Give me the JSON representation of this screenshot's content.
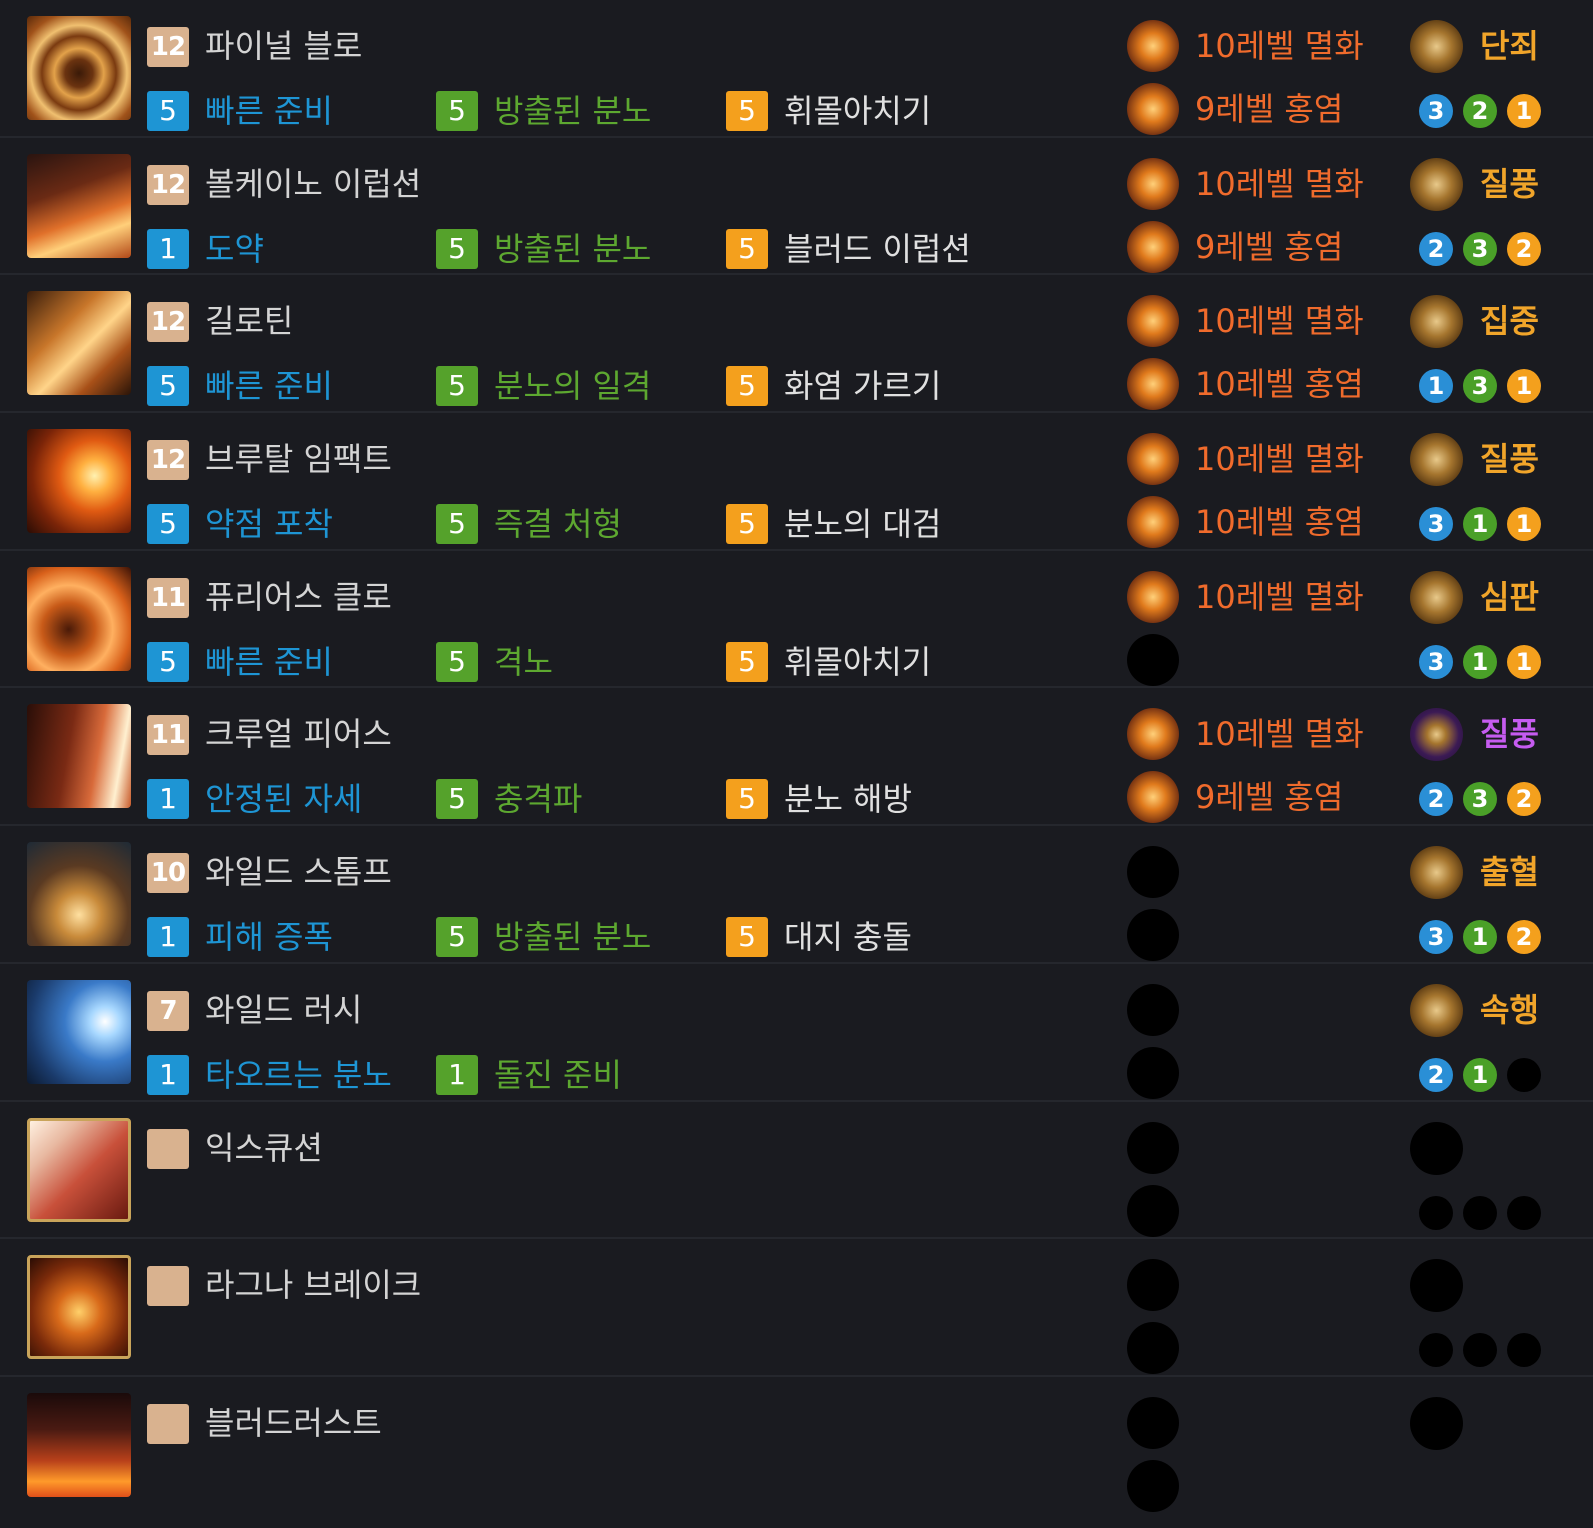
{
  "skills": [
    {
      "name": "파이널 블로",
      "level": "12",
      "icon": "swirl-strike-icon",
      "framed": false,
      "icon_bg": "radial-gradient(circle at 50% 55%, #3a1a08 0%, #6b3310 18%, #e3a24a 32%, #7a3a10 48%, #f0c070 62%, #a0521a 80%, #5a2a0a 100%)",
      "tripods": [
        {
          "level": "5",
          "name": "빠른 준비"
        },
        {
          "level": "5",
          "name": "방출된 분노"
        },
        {
          "level": "5",
          "name": "휘몰아치기"
        }
      ],
      "gems": [
        {
          "label": "10레벨 멸화"
        },
        {
          "label": "9레벨 홍염"
        }
      ],
      "stone": {
        "label": "단죄",
        "style": "normal"
      },
      "dots": [
        "3",
        "2",
        "1"
      ]
    },
    {
      "name": "볼케이노 이럽션",
      "level": "12",
      "icon": "sword-eruption-icon",
      "framed": false,
      "icon_bg": "linear-gradient(160deg, #2a1410 0%, #6a2a14 35%, #e0702a 60%, #ffcf7a 75%, #b24818 100%)",
      "tripods": [
        {
          "level": "1",
          "name": "도약"
        },
        {
          "level": "5",
          "name": "방출된 분노"
        },
        {
          "level": "5",
          "name": "블러드 이럽션"
        }
      ],
      "gems": [
        {
          "label": "10레벨 멸화"
        },
        {
          "label": "9레벨 홍염"
        }
      ],
      "stone": {
        "label": "질풍",
        "style": "normal"
      },
      "dots": [
        "2",
        "3",
        "2"
      ]
    },
    {
      "name": "길로틴",
      "level": "12",
      "icon": "guillotine-slash-icon",
      "framed": false,
      "icon_bg": "linear-gradient(135deg, #3a1e0c 0%, #c8762a 35%, #ffd489 55%, #a85018 75%, #2a1408 100%)",
      "tripods": [
        {
          "level": "5",
          "name": "빠른 준비"
        },
        {
          "level": "5",
          "name": "분노의 일격"
        },
        {
          "level": "5",
          "name": "화염 가르기"
        }
      ],
      "gems": [
        {
          "label": "10레벨 멸화"
        },
        {
          "label": "10레벨 홍염"
        }
      ],
      "stone": {
        "label": "집중",
        "style": "normal"
      },
      "dots": [
        "1",
        "3",
        "1"
      ]
    },
    {
      "name": "브루탈 임팩트",
      "level": "12",
      "icon": "brutal-impact-icon",
      "framed": false,
      "icon_bg": "radial-gradient(circle at 65% 45%, #fff1b0 0%, #ffb040 18%, #e05a12 40%, #7a2408 70%, #2a0c04 100%)",
      "tripods": [
        {
          "level": "5",
          "name": "약점 포착"
        },
        {
          "level": "5",
          "name": "즉결 처형"
        },
        {
          "level": "5",
          "name": "분노의 대검"
        }
      ],
      "gems": [
        {
          "label": "10레벨 멸화"
        },
        {
          "label": "10레벨 홍염"
        }
      ],
      "stone": {
        "label": "질풍",
        "style": "normal"
      },
      "dots": [
        "3",
        "1",
        "1"
      ]
    },
    {
      "name": "퓨리어스 클로",
      "level": "11",
      "icon": "furious-claw-icon",
      "framed": false,
      "icon_bg": "radial-gradient(circle at 40% 60%, #4a1a08 0%, #c85a18 30%, #ffb060 50%, #d8601a 70%, #3a1206 100%)",
      "tripods": [
        {
          "level": "5",
          "name": "빠른 준비"
        },
        {
          "level": "5",
          "name": "격노"
        },
        {
          "level": "5",
          "name": "휘몰아치기"
        }
      ],
      "gems": [
        {
          "label": "10레벨 멸화"
        },
        {
          "label": ""
        }
      ],
      "stone": {
        "label": "심판",
        "style": "normal"
      },
      "dots": [
        "3",
        "1",
        "1"
      ]
    },
    {
      "name": "크루얼 피어스",
      "level": "11",
      "icon": "cruel-pierce-icon",
      "framed": false,
      "icon_bg": "linear-gradient(100deg, #2a0e08 0%, #7a2a14 40%, #d86a3a 65%, #fff0d0 85%, #c85a2a 100%)",
      "tripods": [
        {
          "level": "1",
          "name": "안정된 자세"
        },
        {
          "level": "5",
          "name": "충격파"
        },
        {
          "level": "5",
          "name": "분노 해방"
        }
      ],
      "gems": [
        {
          "label": "10레벨 멸화"
        },
        {
          "label": "9레벨 홍염"
        }
      ],
      "stone": {
        "label": "질풍",
        "style": "purple"
      },
      "dots": [
        "2",
        "3",
        "2"
      ]
    },
    {
      "name": "와일드 스톰프",
      "level": "10",
      "icon": "wild-stomp-icon",
      "framed": false,
      "icon_bg": "radial-gradient(circle at 50% 70%, #ffe0a0 0%, #c88a3a 25%, #5a3a22 55%, #1e2a36 100%)",
      "tripods": [
        {
          "level": "1",
          "name": "피해 증폭"
        },
        {
          "level": "5",
          "name": "방출된 분노"
        },
        {
          "level": "5",
          "name": "대지 충돌"
        }
      ],
      "gems": [
        {
          "label": ""
        },
        {
          "label": ""
        }
      ],
      "stone": {
        "label": "출혈",
        "style": "normal"
      },
      "dots": [
        "3",
        "1",
        "2"
      ]
    },
    {
      "name": "와일드 러시",
      "level": "7",
      "icon": "wild-rush-icon",
      "framed": false,
      "icon_bg": "radial-gradient(circle at 75% 40%, #ffffff 0%, #a8d8ff 15%, #3a7ac8 40%, #1a3a6a 75%, #0c1a30 100%)",
      "tripods": [
        {
          "level": "1",
          "name": "타오르는 분노"
        },
        {
          "level": "1",
          "name": "돌진 준비"
        }
      ],
      "gems": [
        {
          "label": ""
        },
        {
          "label": ""
        }
      ],
      "stone": {
        "label": "속행",
        "style": "normal"
      },
      "dots": [
        "2",
        "1",
        ""
      ]
    },
    {
      "name": "익스큐션",
      "level": "",
      "icon": "execution-icon",
      "framed": true,
      "icon_bg": "linear-gradient(135deg, #fff0e0 0%, #e8b8a0 25%, #c8503a 55%, #6a1a10 100%)",
      "tripods": [],
      "gems": [
        {
          "label": ""
        },
        {
          "label": ""
        }
      ],
      "stone": {
        "label": "",
        "style": "off"
      },
      "dots": [
        "",
        "",
        ""
      ]
    },
    {
      "name": "라그나 브레이크",
      "level": "",
      "icon": "ragna-break-icon",
      "framed": true,
      "icon_bg": "radial-gradient(circle at 50% 55%, #ffd06a 0%, #d86a1a 30%, #7a2a0a 65%, #2a0c04 100%)",
      "tripods": [],
      "gems": [
        {
          "label": ""
        },
        {
          "label": ""
        }
      ],
      "stone": {
        "label": "",
        "style": "off"
      },
      "dots": [
        "",
        "",
        ""
      ]
    },
    {
      "name": "블러드러스트",
      "level": "",
      "icon": "bloodlust-demon-icon",
      "framed": false,
      "icon_bg": "linear-gradient(180deg, #1a0a0a 0%, #4a1a12 35%, #b8401a 65%, #ff9a2a 85%, #e0501a 100%)",
      "tripods": [],
      "gems": [
        {
          "label": ""
        },
        {
          "label": ""
        }
      ],
      "stone": {
        "label": "",
        "style": "off"
      },
      "dots": []
    }
  ]
}
